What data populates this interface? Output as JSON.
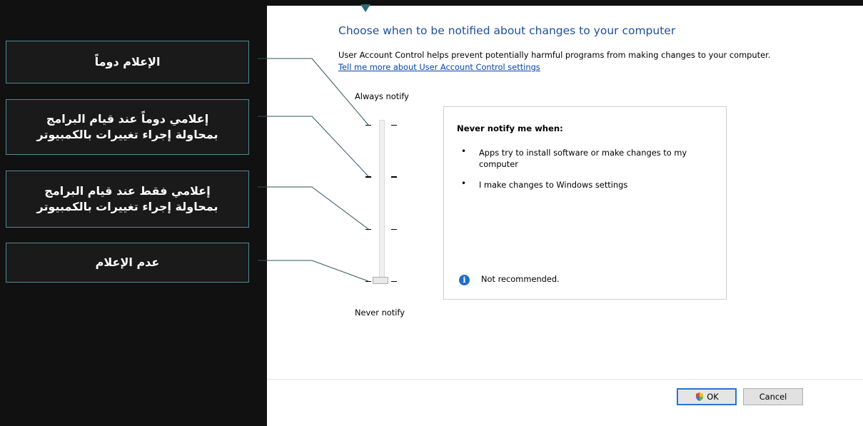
{
  "callouts": {
    "always": "الإعلام دوماً",
    "default_line1": "إعلامي دوماً عند قيام البرامج",
    "default_line2": "بمحاولة إجراء تغييرات بالكمبيوتر",
    "apps_only_line1": "إعلامي فقط عند قيام البرامج",
    "apps_only_line2": "بمحاولة إجراء تغييرات بالكمبيوتر",
    "never": "عدم الإعلام"
  },
  "dialog": {
    "heading": "Choose when to be notified about changes to your computer",
    "description": "User Account Control helps prevent potentially harmful programs from making changes to your computer.",
    "link": "Tell me more about User Account Control settings"
  },
  "slider": {
    "top_label": "Always notify",
    "bottom_label": "Never notify",
    "levels": 4,
    "selected_level": 0
  },
  "info_box": {
    "title": "Never notify me when:",
    "bullets": [
      "Apps try to install software or make changes to my computer",
      "I make changes to Windows settings"
    ],
    "note": "Not recommended.",
    "note_icon": "info-icon"
  },
  "buttons": {
    "ok": "OK",
    "ok_icon": "shield-icon",
    "cancel": "Cancel"
  },
  "colors": {
    "heading": "#1f4e9a",
    "link": "#0645ad",
    "callout_border": "#4e8a93",
    "info_icon": "#1f6fc5"
  }
}
